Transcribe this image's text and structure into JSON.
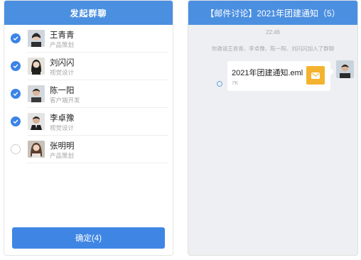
{
  "left": {
    "title": "发起群聊",
    "members": [
      {
        "name": "王青青",
        "role": "产品策划",
        "checked": true,
        "avatar": "avatar-woman-dark-hair"
      },
      {
        "name": "刘闪闪",
        "role": "视觉设计",
        "checked": true,
        "avatar": "avatar-woman-long-hair"
      },
      {
        "name": "陈一阳",
        "role": "客户端开发",
        "checked": true,
        "avatar": "avatar-man-short-hair"
      },
      {
        "name": "李卓豫",
        "role": "视觉设计",
        "checked": true,
        "avatar": "avatar-man-suit"
      },
      {
        "name": "张明明",
        "role": "产品策划",
        "checked": false,
        "avatar": "avatar-woman-brown-hair"
      }
    ],
    "confirm_label": "确定(4)"
  },
  "right": {
    "title": "【邮件讨论】2021年团建通知（5）",
    "time": "22:46",
    "system_message": "你邀请王青青、李卓豫、陈一阳、刘闪闪加入了群聊",
    "file": {
      "name": "2021年团建通知.eml",
      "size": "7K",
      "icon": "mail-icon"
    },
    "colors": {
      "accent": "#4b8fe0",
      "file_icon": "#f4b32e",
      "check": "#3b84e6"
    }
  }
}
